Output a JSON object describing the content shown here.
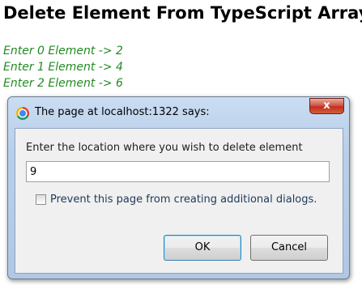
{
  "page": {
    "title": "Delete Element From TypeScript Array",
    "lines": [
      "Enter 0 Element -> 2",
      "Enter 1 Element -> 4",
      "Enter 2 Element -> 6"
    ]
  },
  "dialog": {
    "title": "The page at localhost:1322 says:",
    "close_label": "x",
    "message": "Enter the location where you wish to delete element",
    "input_value": "9",
    "checkbox_label": "Prevent this page from creating additional dialogs.",
    "checkbox_checked": false,
    "ok_label": "OK",
    "cancel_label": "Cancel"
  },
  "icons": {
    "title_icon": "chrome-icon"
  },
  "colors": {
    "line_text": "#228b22",
    "dialog_frame": "#b9cfe9",
    "close_button": "#c2301c"
  }
}
